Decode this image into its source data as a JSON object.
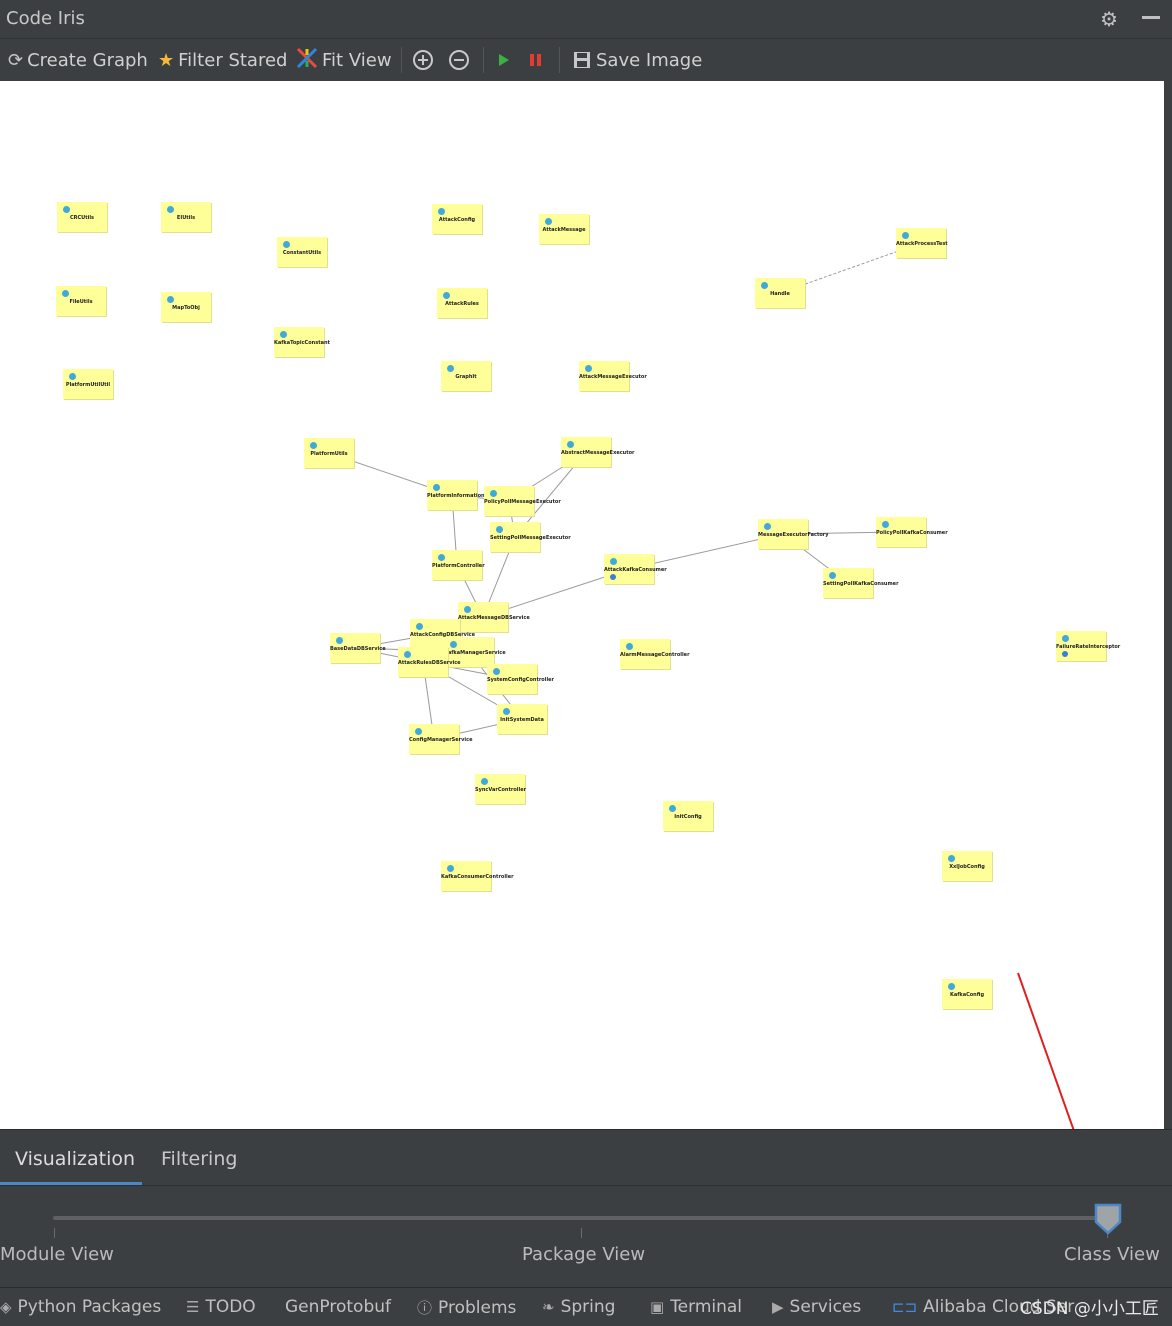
{
  "window": {
    "title": "Code Iris"
  },
  "toolbar": {
    "create_graph": "Create Graph",
    "filter_stared": "Filter Stared",
    "fit_view": "Fit View",
    "save_image": "Save Image"
  },
  "graph": {
    "nodes": [
      "CRCUtils",
      "EIUtils",
      "ConstantUtils",
      "AttackConfig",
      "AttackMessage",
      "AttackProcessTest",
      "Handle",
      "FileUtils",
      "MapToObj",
      "AttackRules",
      "KafkaTopicConstant",
      "GraphIt",
      "AttackMessageExecutor",
      "PlatformUtilUtil",
      "PlatformUtils",
      "AbstractMessageExecutor",
      "PlatformInformationService",
      "PolicyPollMessageExecutor",
      "SettingPollMessageExecutor",
      "MessageExecutorFactory",
      "PolicyPollKafkaConsumer",
      "PlatformController",
      "AttackKafkaConsumer",
      "SettingPollKafkaConsumer",
      "AttackMessageDBService",
      "AttackConfigDBService",
      "BaseDataDBService",
      "KafkaManagerService",
      "AttackRulesDBService",
      "AlarmMessageController",
      "FailureRateInterceptor",
      "SystemConfigController",
      "InitSystemData",
      "ConfigManagerService",
      "SyncVarController",
      "InitConfig",
      "XxlJobConfig",
      "KafkaConsumerController",
      "KafkaConfig"
    ]
  },
  "tabs": {
    "visualization": "Visualization",
    "filtering": "Filtering"
  },
  "slider": {
    "labels": [
      "Module View",
      "Package View",
      "Class View"
    ],
    "selected_index": 2
  },
  "statusbar": {
    "python_packages": "Python Packages",
    "todo": "TODO",
    "genprotobuf": "GenProtobuf",
    "problems": "Problems",
    "spring": "Spring",
    "terminal": "Terminal",
    "services": "Services",
    "alibaba_cloud": "Alibaba Cloud Ser"
  },
  "watermark": "CSDN @小小工匠"
}
